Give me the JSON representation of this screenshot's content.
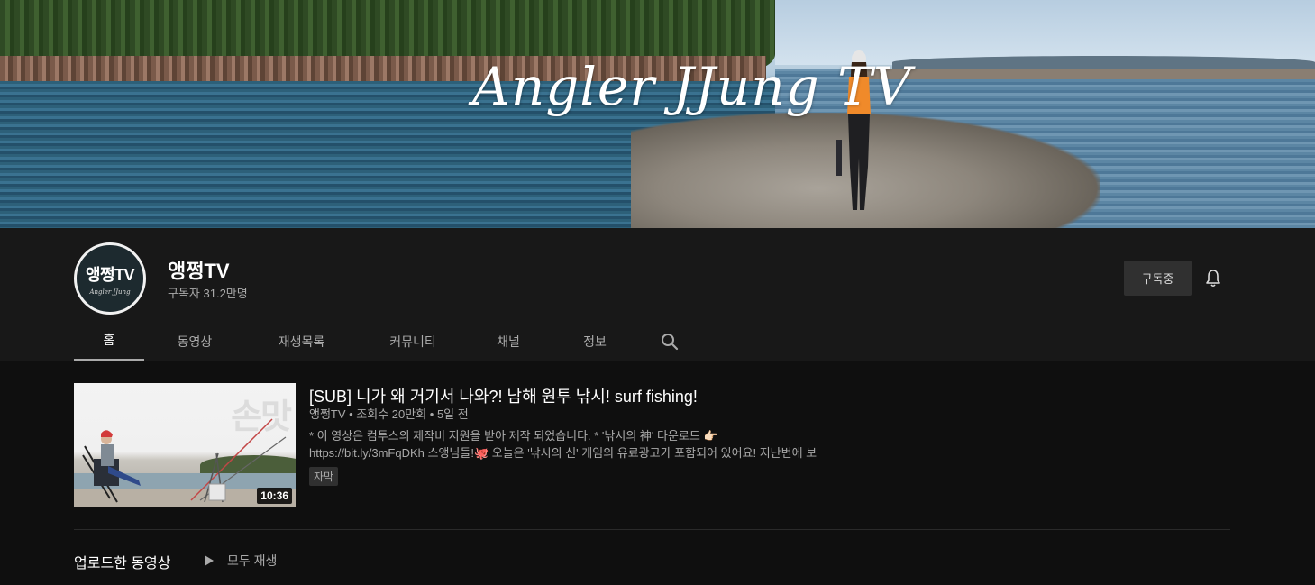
{
  "banner": {
    "logo_text": "Angler JJung TV"
  },
  "channel": {
    "avatar_text": "앵쩡TV",
    "avatar_subtext": "Angler JJung",
    "name": "앵쩡TV",
    "subscribers": "구독자 31.2만명",
    "subscribe_button": "구독중",
    "bell_icon": "bell-icon"
  },
  "tabs": [
    {
      "label": "홈",
      "active": true
    },
    {
      "label": "동영상",
      "active": false
    },
    {
      "label": "재생목록",
      "active": false
    },
    {
      "label": "커뮤니티",
      "active": false
    },
    {
      "label": "채널",
      "active": false
    },
    {
      "label": "정보",
      "active": false
    }
  ],
  "search_icon": "search-icon",
  "featured_video": {
    "title": "[SUB] 니가 왜 거기서 나와?! 남해 원투 낚시! surf fishing!",
    "meta": "앵쩡TV • 조회수 20만회 • 5일 전",
    "description_line1": "* 이 영상은 컴투스의 제작비 지원을 받아 제작 되었습니다. * '낚시의 神' 다운로드 👉🏻",
    "description_line2": "https://bit.ly/3mFqDKh 스앵님들!🐙 오늘은 '낚시의 신' 게임의 유료광고가 포함되어 있어요! 지난번에 보",
    "badge": "자막",
    "duration": "10:36",
    "thumb_watermark": "손맛"
  },
  "uploads": {
    "title": "업로드한 동영상",
    "play_all": "모두 재생"
  },
  "colors": {
    "background": "#0f0f0f",
    "header_bg": "#181818",
    "secondary_text": "#aaaaaa"
  }
}
